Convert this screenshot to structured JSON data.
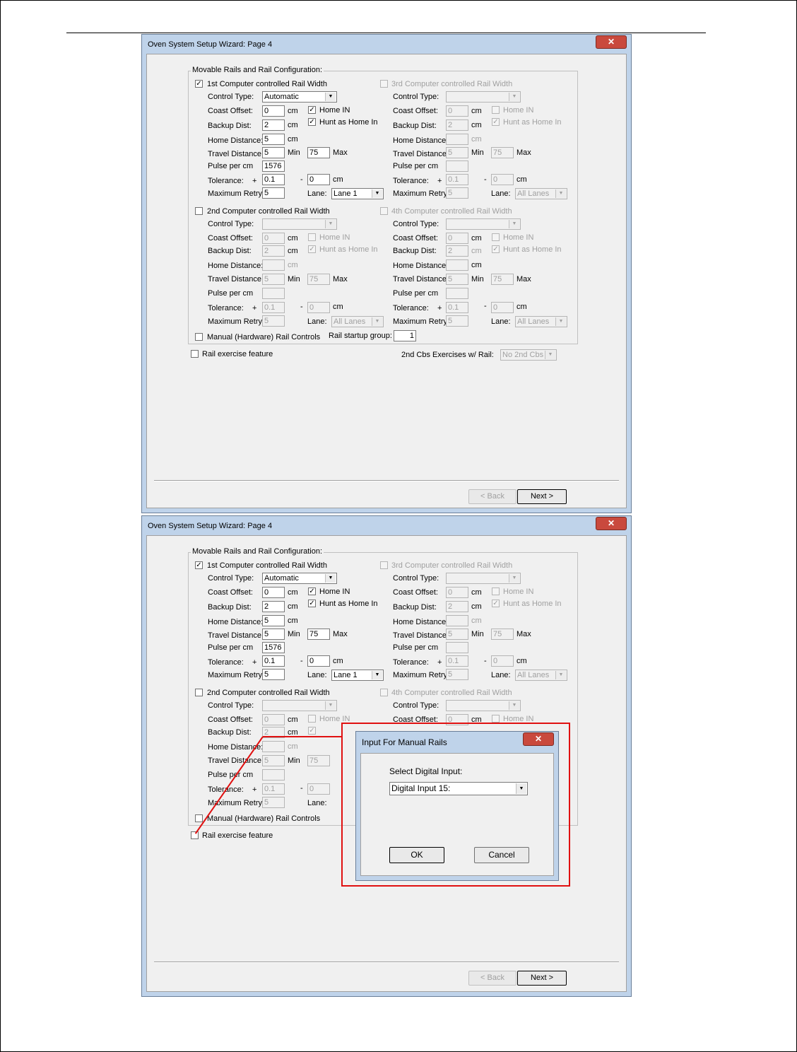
{
  "window": {
    "title": "Oven System Setup Wizard: Page 4",
    "close": "✕"
  },
  "group_title": "Movable Rails and Rail Configuration:",
  "labels": {
    "control_type": "Control Type:",
    "coast_offset": "Coast Offset:",
    "backup_dist": "Backup Dist:",
    "home_distance": "Home Distance:",
    "travel_distance": "Travel Distance:",
    "pulse_per_cm": "Pulse per cm",
    "tolerance": "Tolerance:",
    "maximum_retry": "Maximum Retry:",
    "plus": "+",
    "minus": "-",
    "cm": "cm",
    "min": "Min",
    "max": "Max",
    "lane": "Lane:",
    "home_in": "Home IN",
    "hunt_home_in": "Hunt as Home In"
  },
  "rail1": {
    "label": "1st Computer controlled Rail Width",
    "checked": "✓",
    "control_type": "Automatic",
    "coast": "0",
    "backup": "2",
    "home_dist": "5",
    "travel_min": "5",
    "travel_max": "75",
    "pulse": "1576",
    "tol_plus": "0.1",
    "tol_minus": "0",
    "retry": "5",
    "lane": "Lane 1",
    "home_in_check": "✓",
    "hunt_check": "✓"
  },
  "rail2": {
    "label": "2nd Computer controlled Rail Width",
    "checked": "",
    "control_type": "",
    "coast": "0",
    "backup": "2",
    "home_dist": "",
    "travel_min": "5",
    "travel_max": "75",
    "pulse": "",
    "tol_plus": "0.1",
    "tol_minus": "0",
    "retry": "5",
    "lane": "All Lanes",
    "home_in_check": "",
    "hunt_check": "✓"
  },
  "rail3": {
    "label": "3rd Computer controlled Rail Width",
    "checked": "",
    "control_type": "",
    "coast": "0",
    "backup": "2",
    "home_dist": "",
    "travel_min": "5",
    "travel_max": "75",
    "pulse": "",
    "tol_plus": "0.1",
    "tol_minus": "0",
    "retry": "5",
    "lane": "All Lanes",
    "home_in_check": "",
    "hunt_check": "✓"
  },
  "rail4": {
    "label": "4th Computer controlled Rail Width",
    "checked": "",
    "control_type": "",
    "coast": "0",
    "backup": "2",
    "home_dist": "",
    "travel_min": "5",
    "travel_max": "75",
    "pulse": "",
    "tol_plus": "0.1",
    "tol_minus": "0",
    "retry": "5",
    "lane": "All Lanes",
    "home_in_check": "",
    "hunt_check": "✓"
  },
  "manual_rail": {
    "label": "Manual (Hardware) Rail Controls",
    "startup_label": "Rail startup group:",
    "startup_value": "1"
  },
  "exercise": {
    "label": "Rail exercise feature",
    "cbs_label": "2nd Cbs Exercises w/ Rail:",
    "cbs_value": "No 2nd Cbs"
  },
  "buttons": {
    "back": "< Back",
    "next": "Next >"
  },
  "dialog": {
    "title": "Input For Manual Rails",
    "close": "✕",
    "select_label": "Select Digital Input:",
    "select_value": "Digital Input  15:",
    "ok": "OK",
    "cancel": "Cancel"
  },
  "highlight_color": "#e01010"
}
